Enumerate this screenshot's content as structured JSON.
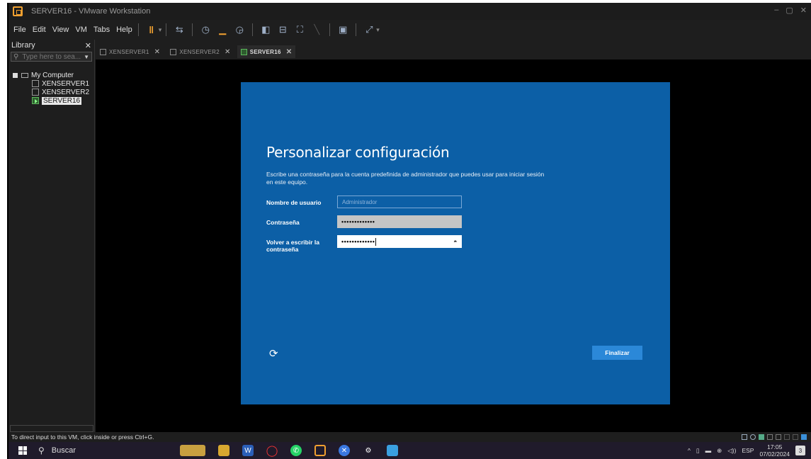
{
  "window": {
    "title": "SERVER16 - VMware Workstation",
    "controls": [
      "–",
      "▢",
      "✕"
    ]
  },
  "menu": {
    "items": [
      "File",
      "Edit",
      "View",
      "VM",
      "Tabs",
      "Help"
    ]
  },
  "library": {
    "title": "Library",
    "close": "✕",
    "search_placeholder": "Type here to sea...",
    "tree": {
      "root": "My Computer",
      "vms": [
        "XENSERVER1",
        "XENSERVER2",
        "SERVER16"
      ],
      "selected": "SERVER16"
    }
  },
  "tabs": [
    {
      "label": "XENSERVER1",
      "active": false
    },
    {
      "label": "XENSERVER2",
      "active": false
    },
    {
      "label": "SERVER16",
      "active": true
    }
  ],
  "oobe": {
    "title": "Personalizar configuración",
    "description": "Escribe una contraseña para la cuenta predefinida de administrador que puedes usar para iniciar sesión en este equipo.",
    "username_label": "Nombre de usuario",
    "username_placeholder": "Administrador",
    "password_label": "Contraseña",
    "password_value": "•••••••••••••",
    "confirm_label": "Volver a escribir la contraseña",
    "confirm_value": "•••••••••••••",
    "finish_button": "Finalizar",
    "background_color": "#0c5fa6"
  },
  "status": {
    "text": "To direct input to this VM, click inside or press Ctrl+G."
  },
  "taskbar": {
    "search_label": "Buscar",
    "language": "ESP",
    "time": "17:05",
    "date": "07/02/2024",
    "notifications": "3"
  }
}
